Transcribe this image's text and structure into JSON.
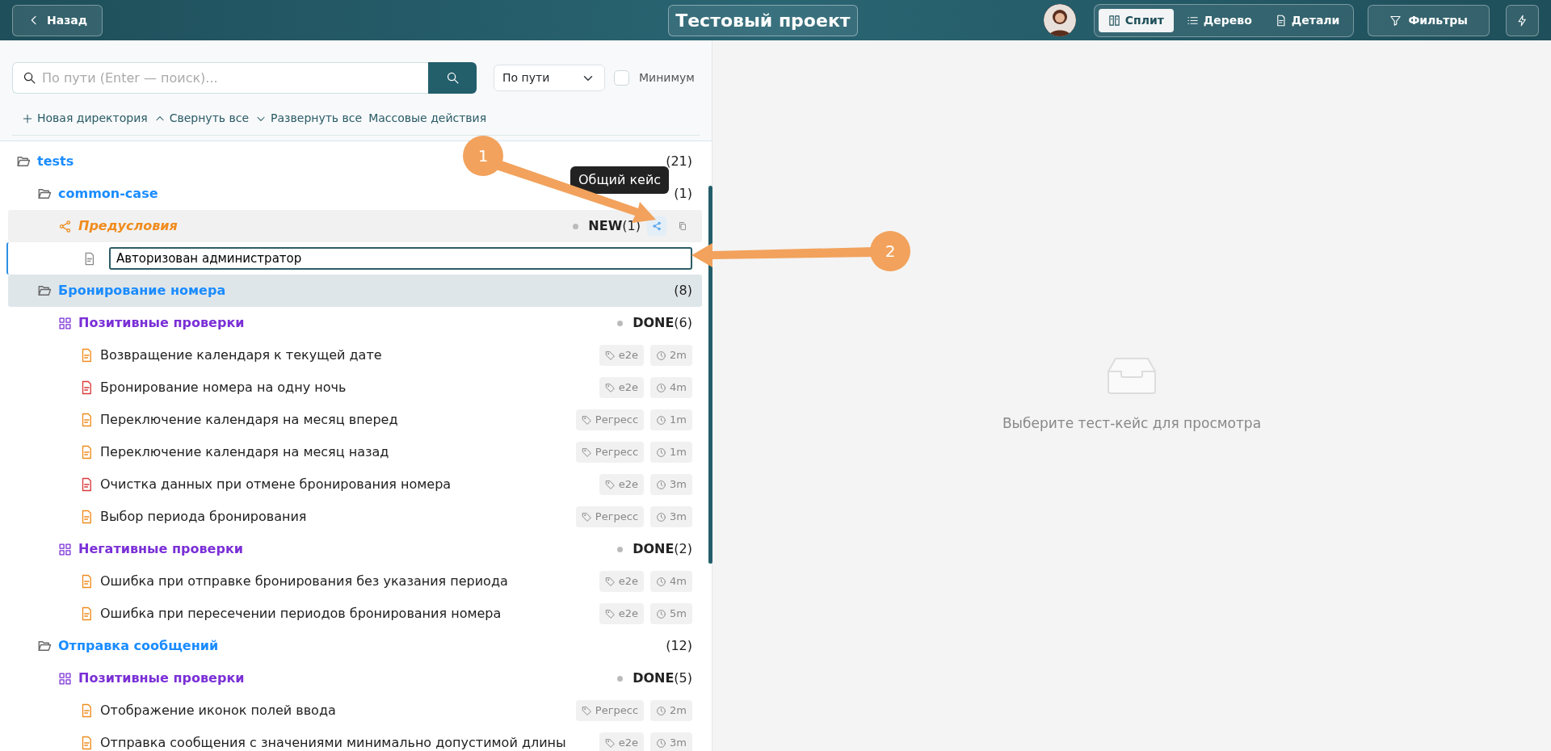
{
  "header": {
    "back": "Назад",
    "title": "Тестовый проект",
    "views": [
      {
        "label": "Сплит",
        "selected": true
      },
      {
        "label": "Дерево",
        "selected": false
      },
      {
        "label": "Детали",
        "selected": false
      }
    ],
    "filters": "Фильтры"
  },
  "search": {
    "placeholder": "По пути (Enter — поиск)...",
    "mode": "По пути",
    "minimum": {
      "label": "Минимум",
      "checked": false
    }
  },
  "actions": [
    {
      "label": "Новая директория"
    },
    {
      "label": "Свернуть все"
    },
    {
      "label": "Развернуть все"
    },
    {
      "label": "Массовые действия"
    }
  ],
  "tree": [
    {
      "kind": "folder",
      "label": "tests",
      "count": "(21)",
      "expanded": true,
      "selected": false,
      "children": [
        {
          "kind": "folder",
          "label": "common-case",
          "count": "(1)",
          "expanded": true,
          "selected": false,
          "children": [
            {
              "kind": "precondition",
              "label": "Предусловия",
              "status": "NEW",
              "count": "(1)",
              "selected": false,
              "children": [
                {
                  "kind": "step",
                  "value": "Авторизован администратор",
                  "selected": false
                }
              ]
            }
          ]
        },
        {
          "kind": "folder",
          "label": "Бронирование номера",
          "count": "(8)",
          "expanded": true,
          "selected": true,
          "children": [
            {
              "kind": "suite",
              "label": "Позитивные проверки",
              "status": "DONE",
              "count": "(6)",
              "selected": false,
              "children": [
                {
                  "kind": "case",
                  "label": "Возвращение календаря к текущей дате",
                  "color": "#f08c1e",
                  "tag": "e2e",
                  "duration": "2m",
                  "selected": false
                },
                {
                  "kind": "case",
                  "label": "Бронирование номера на одну ночь",
                  "color": "#d93a3a",
                  "tag": "e2e",
                  "duration": "4m",
                  "selected": false
                },
                {
                  "kind": "case",
                  "label": "Переключение календаря на месяц вперед",
                  "color": "#f08c1e",
                  "tag": "Регресс",
                  "duration": "1m",
                  "selected": false
                },
                {
                  "kind": "case",
                  "label": "Переключение календаря на месяц назад",
                  "color": "#f08c1e",
                  "tag": "Регресс",
                  "duration": "1m",
                  "selected": false
                },
                {
                  "kind": "case",
                  "label": "Очистка данных при отмене бронирования номера",
                  "color": "#d93a3a",
                  "tag": "e2e",
                  "duration": "3m",
                  "selected": false
                },
                {
                  "kind": "case",
                  "label": "Выбор периода бронирования",
                  "color": "#f08c1e",
                  "tag": "Регресс",
                  "duration": "3m",
                  "selected": false
                }
              ]
            },
            {
              "kind": "suite",
              "label": "Негативные проверки",
              "status": "DONE",
              "count": "(2)",
              "selected": false,
              "children": [
                {
                  "kind": "case",
                  "label": "Ошибка при отправке бронирования без указания периода",
                  "color": "#f08c1e",
                  "tag": "e2e",
                  "duration": "4m",
                  "selected": false
                },
                {
                  "kind": "case",
                  "label": "Ошибка при пересечении периодов бронирования номера",
                  "color": "#f08c1e",
                  "tag": "e2e",
                  "duration": "5m",
                  "selected": false
                }
              ]
            }
          ]
        },
        {
          "kind": "folder",
          "label": "Отправка сообщений",
          "count": "(12)",
          "expanded": true,
          "selected": false,
          "children": [
            {
              "kind": "suite",
              "label": "Позитивные проверки",
              "status": "DONE",
              "count": "(5)",
              "selected": false,
              "children": [
                {
                  "kind": "case",
                  "label": "Отображение иконок полей ввода",
                  "color": "#f08c1e",
                  "tag": "Регресс",
                  "duration": "2m",
                  "selected": false
                },
                {
                  "kind": "case",
                  "label": "Отправка сообщения с значениями минимально допустимой длины",
                  "color": "#f08c1e",
                  "tag": "e2e",
                  "duration": "3m",
                  "selected": false
                }
              ]
            }
          ]
        }
      ]
    }
  ],
  "tooltip": "Общий кейс",
  "empty_state": "Выберите тест-кейс для просмотра",
  "annotations": [
    {
      "label": "1"
    },
    {
      "label": "2"
    }
  ]
}
